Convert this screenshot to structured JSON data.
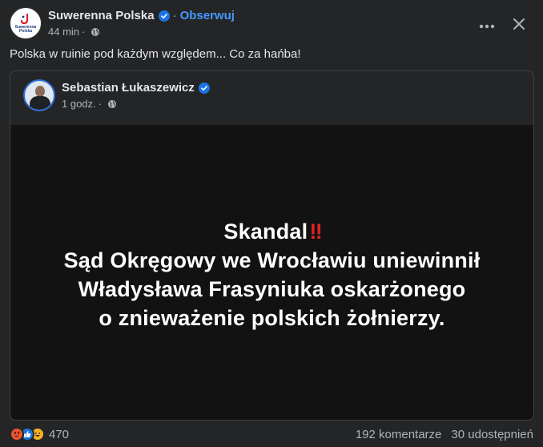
{
  "post": {
    "page_name": "Suwerenna Polska",
    "avatar_text": "Suwerenna Polska",
    "separator": "·",
    "follow_label": "Obserwuj",
    "time": "44 min",
    "caption": "Polska w ruinie pod każdym względem... Co za hańba!"
  },
  "shared": {
    "author_name": "Sebastian Łukaszewicz",
    "time": "1 godz.",
    "image_text": {
      "line1": "Skandal",
      "line1_emoji": "‼",
      "line2": "Sąd Okręgowy we Wrocławiu uniewinnił",
      "line3": "Władysława Frasyniuka oskarżonego",
      "line4": "o znieważenie polskich żołnierzy."
    }
  },
  "footer": {
    "reaction_count": "470",
    "comments": "192 komentarze",
    "shares": "30 udostępnień"
  },
  "colors": {
    "background": "#242526",
    "accent": "#4599ff",
    "verified": "#1b74e4",
    "image_bg": "#121212"
  },
  "icons": [
    "verified-badge-icon",
    "globe-icon",
    "more-icon",
    "close-icon",
    "angry-reaction-icon",
    "like-reaction-icon",
    "haha-reaction-icon"
  ]
}
